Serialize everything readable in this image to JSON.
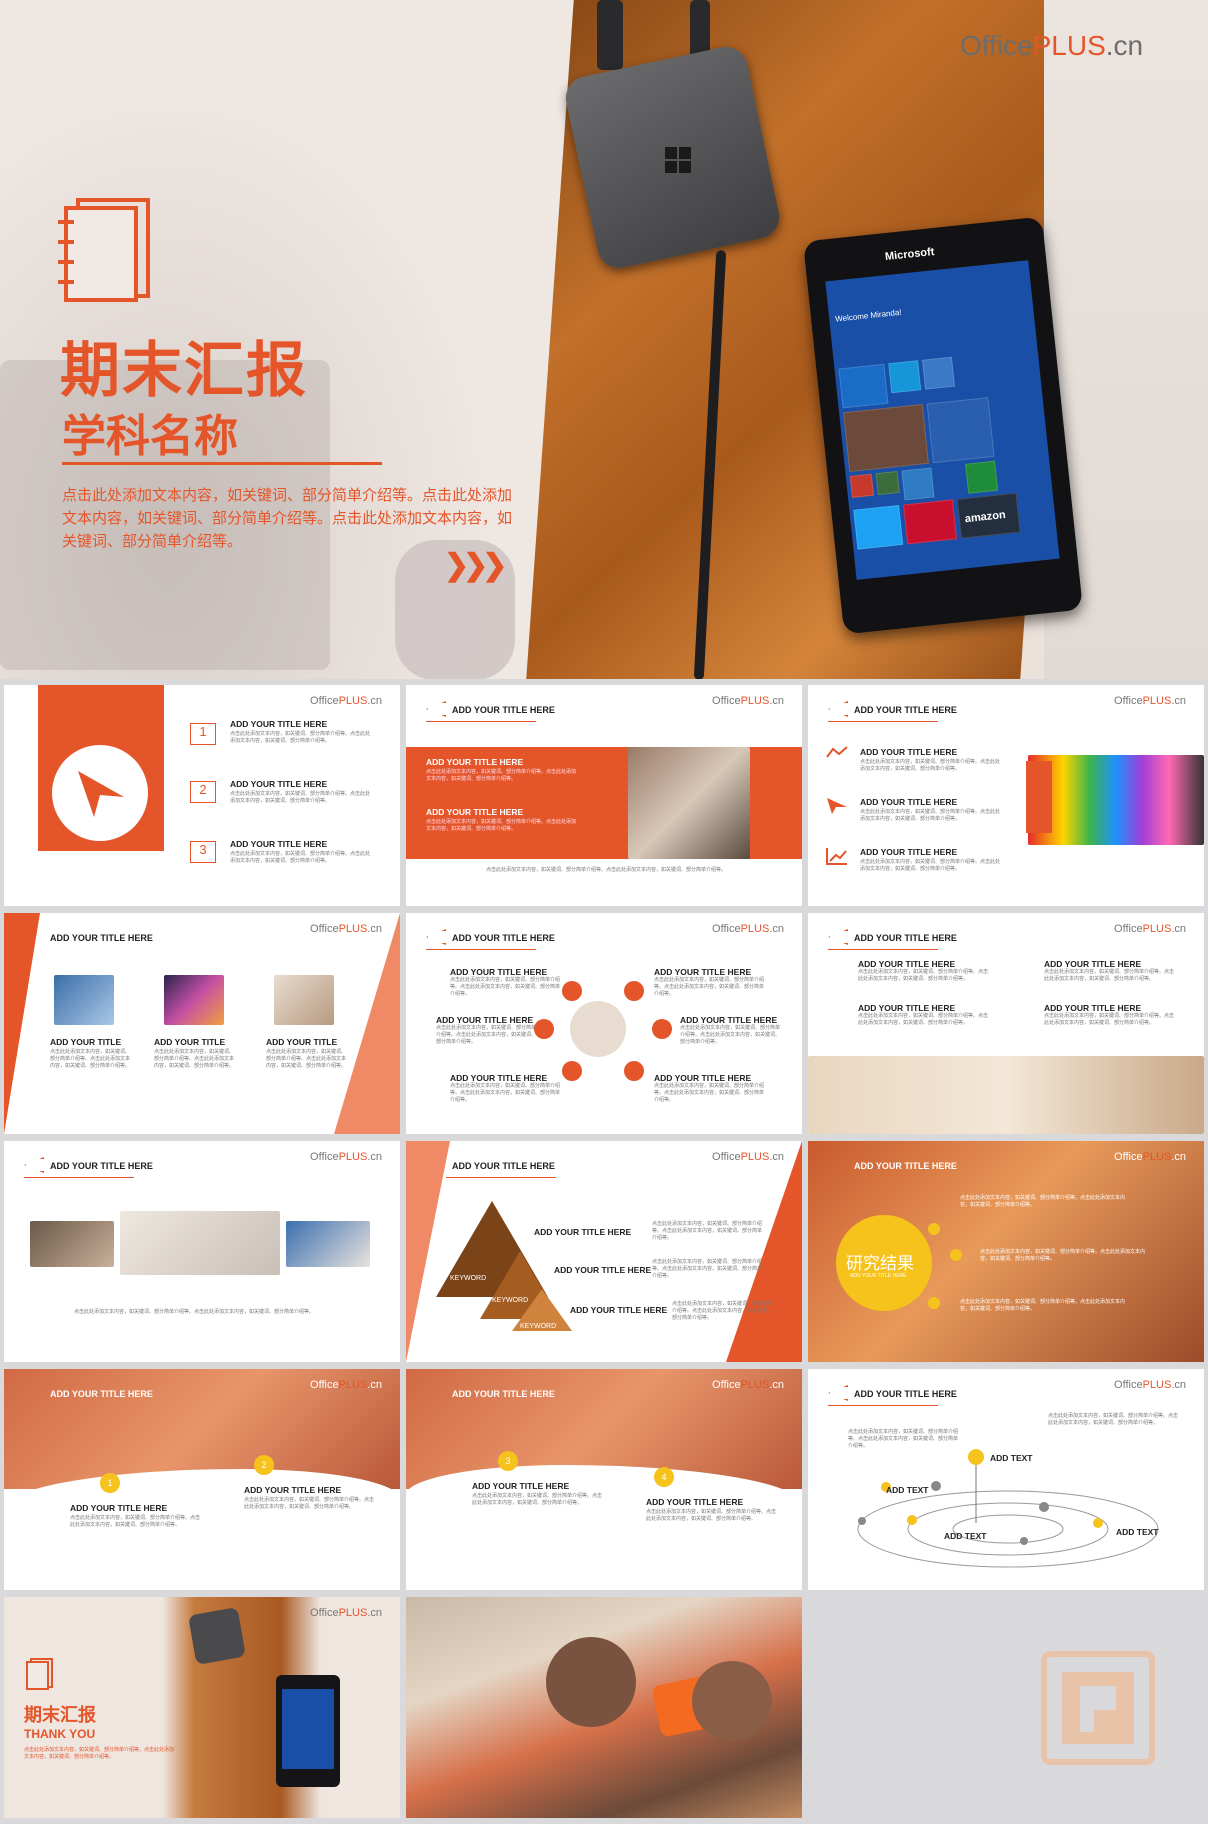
{
  "hero": {
    "logo_left": "Office",
    "logo_mid": "PLUS",
    "logo_right": ".cn",
    "title": "期末汇报",
    "subtitle": "学科名称",
    "description": "点击此处添加文本内容，如关键词、部分简单介绍等。点击此处添加文本内容，如关键词、部分简单介绍等。点击此处添加文本内容，如关键词、部分简单介绍等。",
    "chevrons": "❯❯❯",
    "phone_brand": "Microsoft",
    "phone_greeting": "Welcome Miranda!",
    "phone_amazon": "amazon"
  },
  "slides": {
    "logo_left": "Office",
    "logo_mid": "PLUS",
    "logo_right": ".cn",
    "add_title": "ADD YOUR TITLE HERE",
    "add_title_short": "ADD YOUR TITLE",
    "add_text": "ADD TEXT",
    "keyword": "KEYWORD",
    "body": "点击此处添加文本内容，如关键词、部分简单介绍等。点击此处添加文本内容，如关键词、部分简单介绍等。",
    "nums": [
      "1",
      "2",
      "3",
      "4"
    ],
    "research": "研究结果",
    "research_sub": "ADD YOUR TITLE HERE",
    "end_title": "期末汇报",
    "thank_you": "THANK YOU"
  },
  "colors": {
    "accent": "#e5552a",
    "yellow": "#f6c21c"
  }
}
